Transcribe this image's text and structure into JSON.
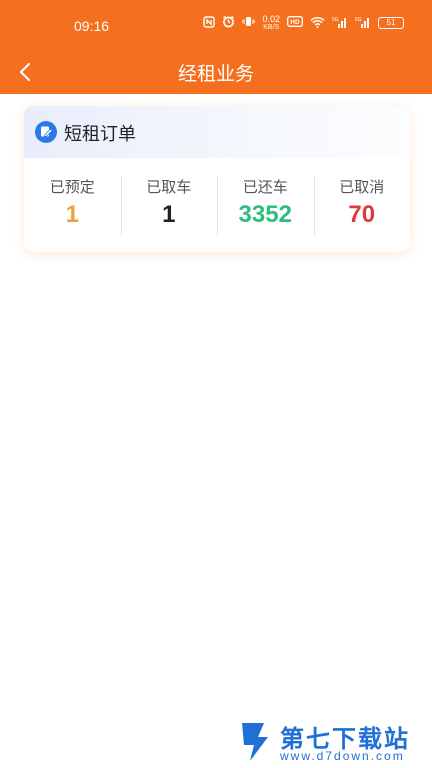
{
  "status_bar": {
    "time": "09:16",
    "net_speed_value": "0.02",
    "net_speed_unit": "KB/S",
    "battery": "51"
  },
  "nav": {
    "title": "经租业务"
  },
  "card": {
    "title": "短租订单",
    "stats": [
      {
        "label": "已预定",
        "value": "1",
        "color": "#f0a040"
      },
      {
        "label": "已取车",
        "value": "1",
        "color": "#222222"
      },
      {
        "label": "已还车",
        "value": "3352",
        "color": "#2cbf7c"
      },
      {
        "label": "已取消",
        "value": "70",
        "color": "#e0383e"
      }
    ]
  },
  "watermark": {
    "name": "第七下载站",
    "url": "www.d7down.com"
  },
  "colors": {
    "brand": "#f5701e",
    "watermark_blue": "#1f6fd6"
  }
}
